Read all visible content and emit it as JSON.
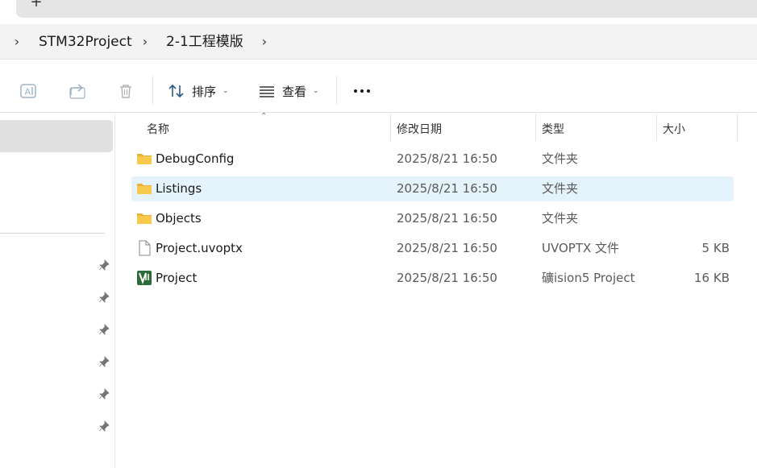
{
  "tabstrip": {
    "new_tab_label": "+"
  },
  "breadcrumb": {
    "items": [
      "STM32Project",
      "2-1工程模版"
    ],
    "separator": "›"
  },
  "toolbar": {
    "sort_label": "排序",
    "view_label": "查看"
  },
  "columns": {
    "name": "名称",
    "date": "修改日期",
    "type": "类型",
    "size": "大小"
  },
  "files": [
    {
      "name": "DebugConfig",
      "date": "2025/8/21 16:50",
      "type": "文件夹",
      "size": "",
      "icon": "folder-icon"
    },
    {
      "name": "Listings",
      "date": "2025/8/21 16:50",
      "type": "文件夹",
      "size": "",
      "icon": "folder-icon"
    },
    {
      "name": "Objects",
      "date": "2025/8/21 16:50",
      "type": "文件夹",
      "size": "",
      "icon": "folder-icon"
    },
    {
      "name": "Project.uvoptx",
      "date": "2025/8/21 16:50",
      "type": "UVOPTX 文件",
      "size": "5 KB",
      "icon": "file-icon"
    },
    {
      "name": "Project",
      "date": "2025/8/21 16:50",
      "type": "礦ision5 Project",
      "size": "16 KB",
      "icon": "uvision-icon"
    }
  ],
  "colors": {
    "accent": "#0067c0",
    "folder": "#f8c94a",
    "hover_row": "#e5f3fd",
    "selected_nav": "#e0e0e0"
  }
}
